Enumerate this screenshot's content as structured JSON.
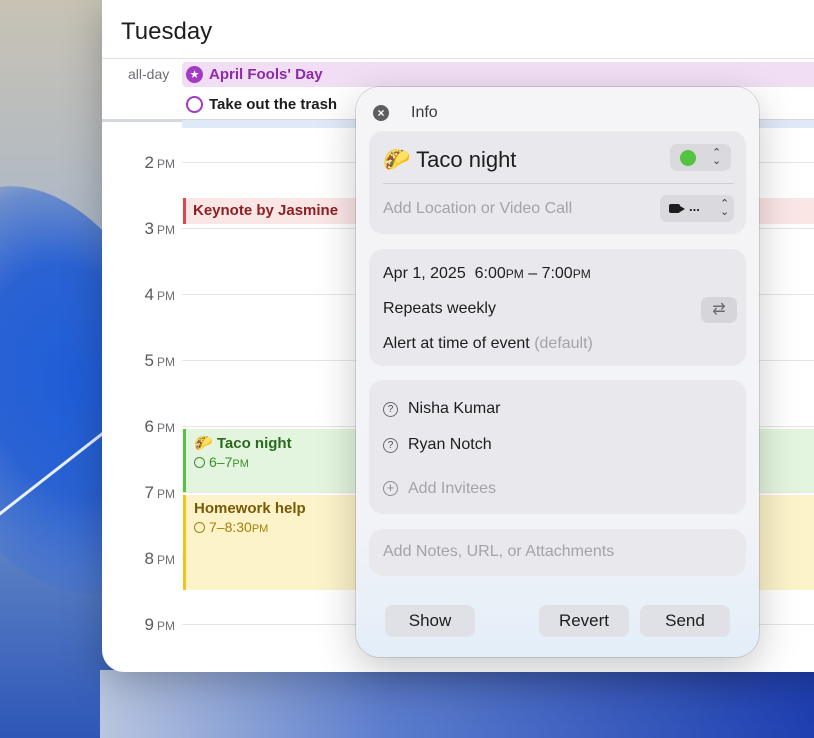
{
  "calendar": {
    "day_title": "Tuesday",
    "allday_label": "all-day",
    "allday_events": [
      {
        "title": "April Fools' Day"
      },
      {
        "title": "Take out the trash"
      }
    ],
    "hours": [
      {
        "num": "2",
        "suffix": "PM"
      },
      {
        "num": "3",
        "suffix": "PM"
      },
      {
        "num": "4",
        "suffix": "PM"
      },
      {
        "num": "5",
        "suffix": "PM"
      },
      {
        "num": "6",
        "suffix": "PM"
      },
      {
        "num": "7",
        "suffix": "PM"
      },
      {
        "num": "8",
        "suffix": "PM"
      },
      {
        "num": "9",
        "suffix": "PM"
      }
    ],
    "events": {
      "keynote": {
        "title": "Keynote by Jasmine"
      },
      "taco": {
        "emoji": "🌮",
        "title": "Taco night",
        "time": "6–7",
        "time_suffix": "PM"
      },
      "homework": {
        "title": "Homework help",
        "time": "7–8:30",
        "time_suffix": "PM"
      }
    },
    "colors": {
      "purple": "#a33ac4",
      "red": "#e0454a",
      "green": "#55c23f",
      "yellow": "#efc41a"
    }
  },
  "popover": {
    "title": "Info",
    "event_emoji": "🌮",
    "event_name": "Taco night",
    "calendar_color": "#54c33f",
    "location_placeholder": "Add Location or Video Call",
    "video_menu": "...",
    "date": "Apr 1, 2025",
    "start_time": "6:00",
    "start_suffix": "PM",
    "end_time": "7:00",
    "end_suffix": "PM",
    "repeat": "Repeats weekly",
    "alert": "Alert at time of event",
    "alert_default": "(default)",
    "invitees": [
      "Nisha Kumar",
      "Ryan Notch"
    ],
    "add_invitees": "Add Invitees",
    "notes_placeholder": "Add Notes, URL, or Attachments",
    "buttons": {
      "show": "Show",
      "revert": "Revert",
      "send": "Send"
    }
  }
}
